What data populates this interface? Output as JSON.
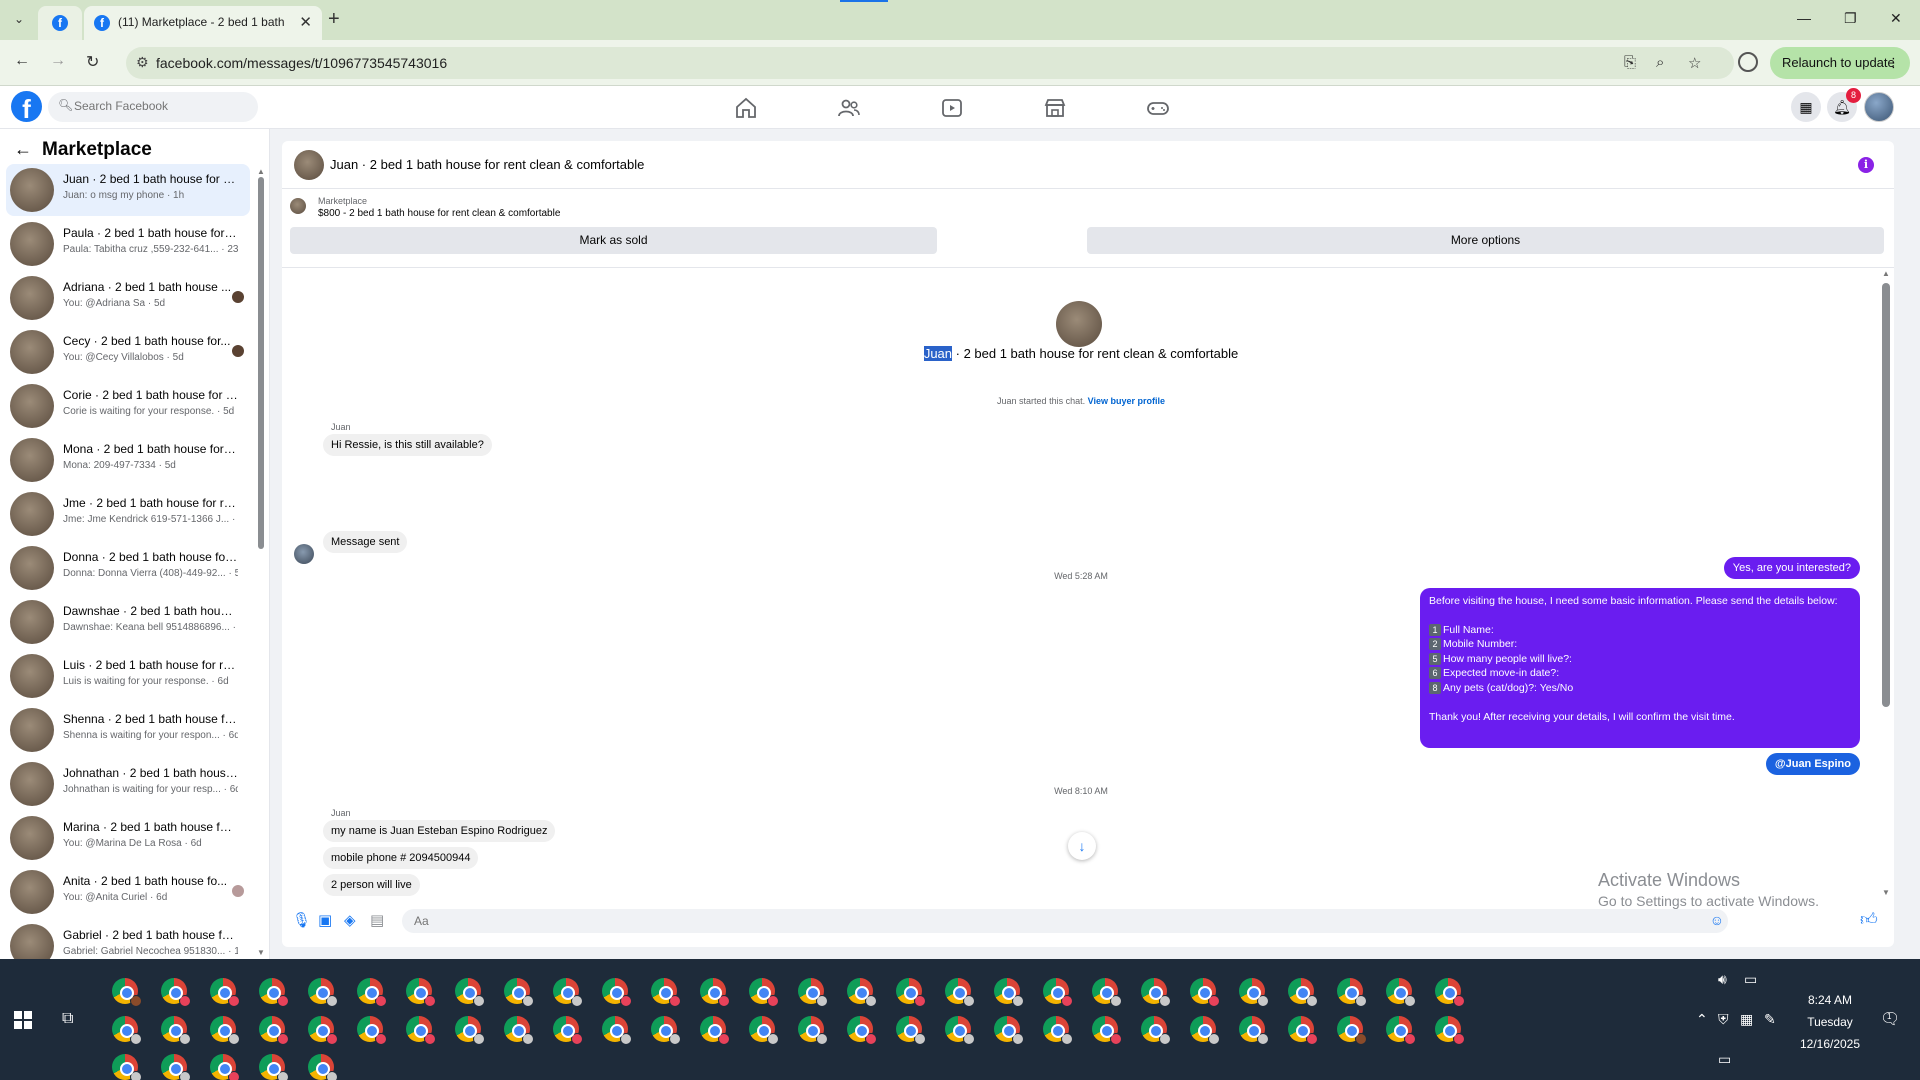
{
  "browser": {
    "tab_title": "(11) Marketplace - 2 bed 1 bath",
    "url": "facebook.com/messages/t/1096773545743016",
    "relaunch_label": "Relaunch to update"
  },
  "fb": {
    "search_placeholder": "Search Facebook",
    "notification_count": "8"
  },
  "sidebar": {
    "title": "Marketplace",
    "conversations": [
      {
        "name": "Juan · 2 bed 1 bath house for re...",
        "sub": "Juan: o msg my phone · 1h"
      },
      {
        "name": "Paula · 2 bed 1 bath house for r...",
        "sub": "Paula: Tabitha cruz ,559-232-641... · 23h"
      },
      {
        "name": "Adriana · 2 bed 1 bath house ...",
        "sub": "You: @Adriana Sa · 5d"
      },
      {
        "name": "Cecy · 2 bed 1 bath house for...",
        "sub": "You: @Cecy Villalobos · 5d"
      },
      {
        "name": "Corie · 2 bed 1 bath house for r...",
        "sub": "Corie is waiting for your response. · 5d"
      },
      {
        "name": "Mona · 2 bed 1 bath house for r...",
        "sub": "Mona: 209-497-7334 · 5d"
      },
      {
        "name": "Jme · 2 bed 1 bath house for re...",
        "sub": "Jme: Jme Kendrick 619-571-1366 J... · 5d"
      },
      {
        "name": "Donna · 2 bed 1 bath house for ...",
        "sub": "Donna: Donna Vierra (408)-449-92... · 5d"
      },
      {
        "name": "Dawnshae · 2 bed 1 bath house ...",
        "sub": "Dawnshae: Keana bell 9514886896... · 5d"
      },
      {
        "name": "Luis · 2 bed 1 bath house for re...",
        "sub": "Luis is waiting for your response. · 6d"
      },
      {
        "name": "Shenna · 2 bed 1 bath house for...",
        "sub": "Shenna is waiting for your respon... · 6d"
      },
      {
        "name": "Johnathan · 2 bed 1 bath house ...",
        "sub": "Johnathan is waiting for your resp... · 6d"
      },
      {
        "name": "Marina · 2 bed 1 bath house for...",
        "sub": "You: @Marina De La Rosa · 6d"
      },
      {
        "name": "Anita · 2 bed 1 bath house fo...",
        "sub": "You: @Anita Curiel · 6d"
      },
      {
        "name": "Gabriel · 2 bed 1 bath house for...",
        "sub": "Gabriel: Gabriel Necochea 951830... · 1w"
      }
    ]
  },
  "chat": {
    "header_title": "Juan · 2 bed 1 bath house for rent clean & comfortable",
    "marketplace_label": "Marketplace",
    "listing": "$800 - 2 bed 1 bath house for rent clean & comfortable",
    "mark_sold": "Mark as sold",
    "more_options": "More options",
    "intro_name": "Juan",
    "intro_rest": " · 2 bed 1 bath house for rent clean & comfortable",
    "started_text": "Juan started this chat.",
    "view_profile": "View buyer profile",
    "sender_name": "Juan",
    "msg_available": "Hi Ressie, is this still available?",
    "msg_sent": "Message sent",
    "time1": "Wed 5:28 AM",
    "out_interested": "Yes, are you interested?",
    "out_long_intro": "Before visiting the house, I need some basic information. Please send the details below:",
    "out_list": [
      {
        "n": "1",
        "t": "Full Name:"
      },
      {
        "n": "2",
        "t": "Mobile Number:"
      },
      {
        "n": "5",
        "t": "How many people will live?:"
      },
      {
        "n": "6",
        "t": "Expected move-in date?:"
      },
      {
        "n": "8",
        "t": "Any pets (cat/dog)?: Yes/No"
      }
    ],
    "out_long_outro": "Thank you! After receiving your details, I will confirm the visit time.",
    "out_mention": "@Juan Espino",
    "time2": "Wed 8:10 AM",
    "sender_name2": "Juan",
    "msg_name": "my name is Juan Esteban Espino Rodriguez",
    "msg_phone": "mobile phone # 2094500944",
    "msg_people": "2  person will live",
    "composer_placeholder": "Aa"
  },
  "windows": {
    "watermark_title": "Activate Windows",
    "watermark_sub": "Go to Settings to activate Windows.",
    "time": "8:24 AM",
    "day": "Tuesday",
    "date": "12/16/2025",
    "notif_count": "1"
  },
  "colors": {
    "fb_blue": "#1877f2",
    "outgoing_bubble": "#6a1df0",
    "mention_bubble": "#1b62e0",
    "taskbar": "#1e2b3a"
  }
}
